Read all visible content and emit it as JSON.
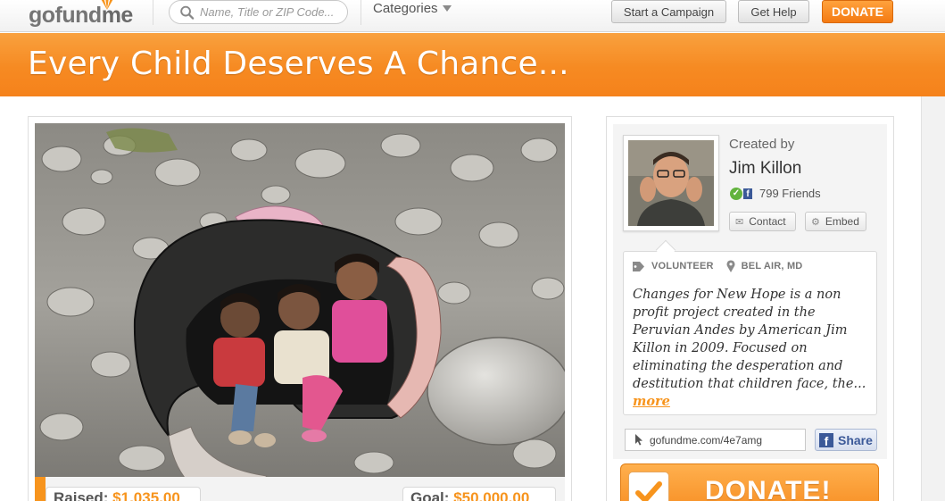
{
  "header": {
    "logo_prefix": "gofund",
    "logo_suffix": "me",
    "search_placeholder": "Name, Title or ZIP Code...",
    "categories_label": "Categories",
    "start_campaign_label": "Start a Campaign",
    "get_help_label": "Get Help",
    "donate_label": "DONATE"
  },
  "campaign": {
    "title": "Every Child Deserves A Chance...",
    "raised_label": "Raised:",
    "raised_value": "$1,035.00",
    "goal_label": "Goal:",
    "goal_value": "$50,000.00",
    "progress_fraction": 0.02
  },
  "creator": {
    "created_by_label": "Created by",
    "name": "Jim Killon",
    "friends_text": "799 Friends",
    "contact_label": "Contact",
    "embed_label": "Embed"
  },
  "about": {
    "category": "VOLUNTEER",
    "location": "BEL AIR, MD",
    "description": "Changes for New Hope is a non profit project created in the Peruvian Andes by American Jim Killon in 2009. Focused on eliminating the desperation and destitution that children face, the...",
    "more_label": "more"
  },
  "share": {
    "short_url": "gofundme.com/4e7amg",
    "share_label": "Share"
  },
  "donate_big_label": "DONATE!",
  "colors": {
    "accent": "#f7941d",
    "facebook": "#3b5998",
    "verified": "#62b33e"
  },
  "icons": [
    "search-icon",
    "chevron-down-icon",
    "tag-icon",
    "location-pin-icon",
    "cursor-icon",
    "facebook-icon",
    "checkmark-icon",
    "envelope-icon",
    "gear-icon"
  ]
}
